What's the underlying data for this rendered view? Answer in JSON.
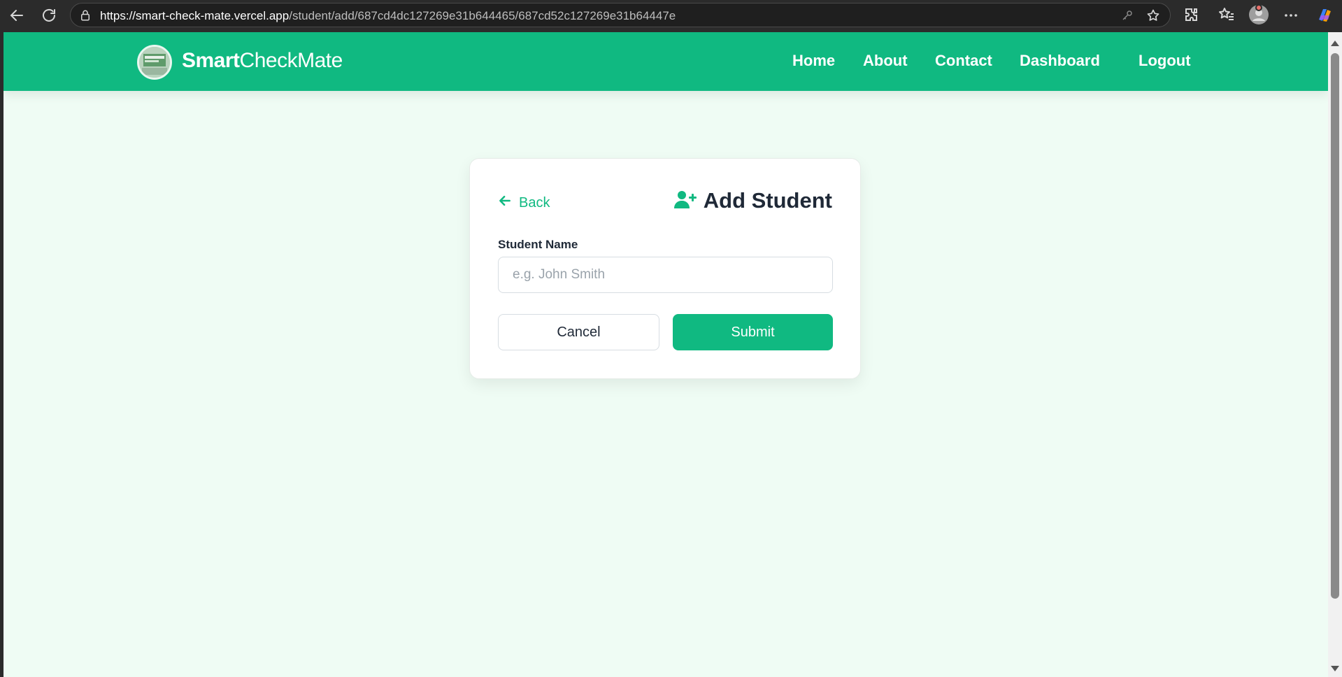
{
  "browser": {
    "url_host": "https://smart-check-mate.vercel.app",
    "url_path": "/student/add/687cd4dc127269e31b644465/687cd52c127269e31b64447e"
  },
  "brand": {
    "name_bold": "Smart",
    "name_rest": "CheckMate"
  },
  "nav": {
    "home": "Home",
    "about": "About",
    "contact": "Contact",
    "dashboard": "Dashboard",
    "logout": "Logout"
  },
  "form": {
    "back_label": "Back",
    "title": "Add Student",
    "student_name_label": "Student Name",
    "student_name_placeholder": "e.g. John Smith",
    "student_name_value": "",
    "cancel_label": "Cancel",
    "submit_label": "Submit"
  },
  "colors": {
    "brand_green": "#10b981",
    "page_background": "#effcf4",
    "heading_text": "#1f2937"
  }
}
